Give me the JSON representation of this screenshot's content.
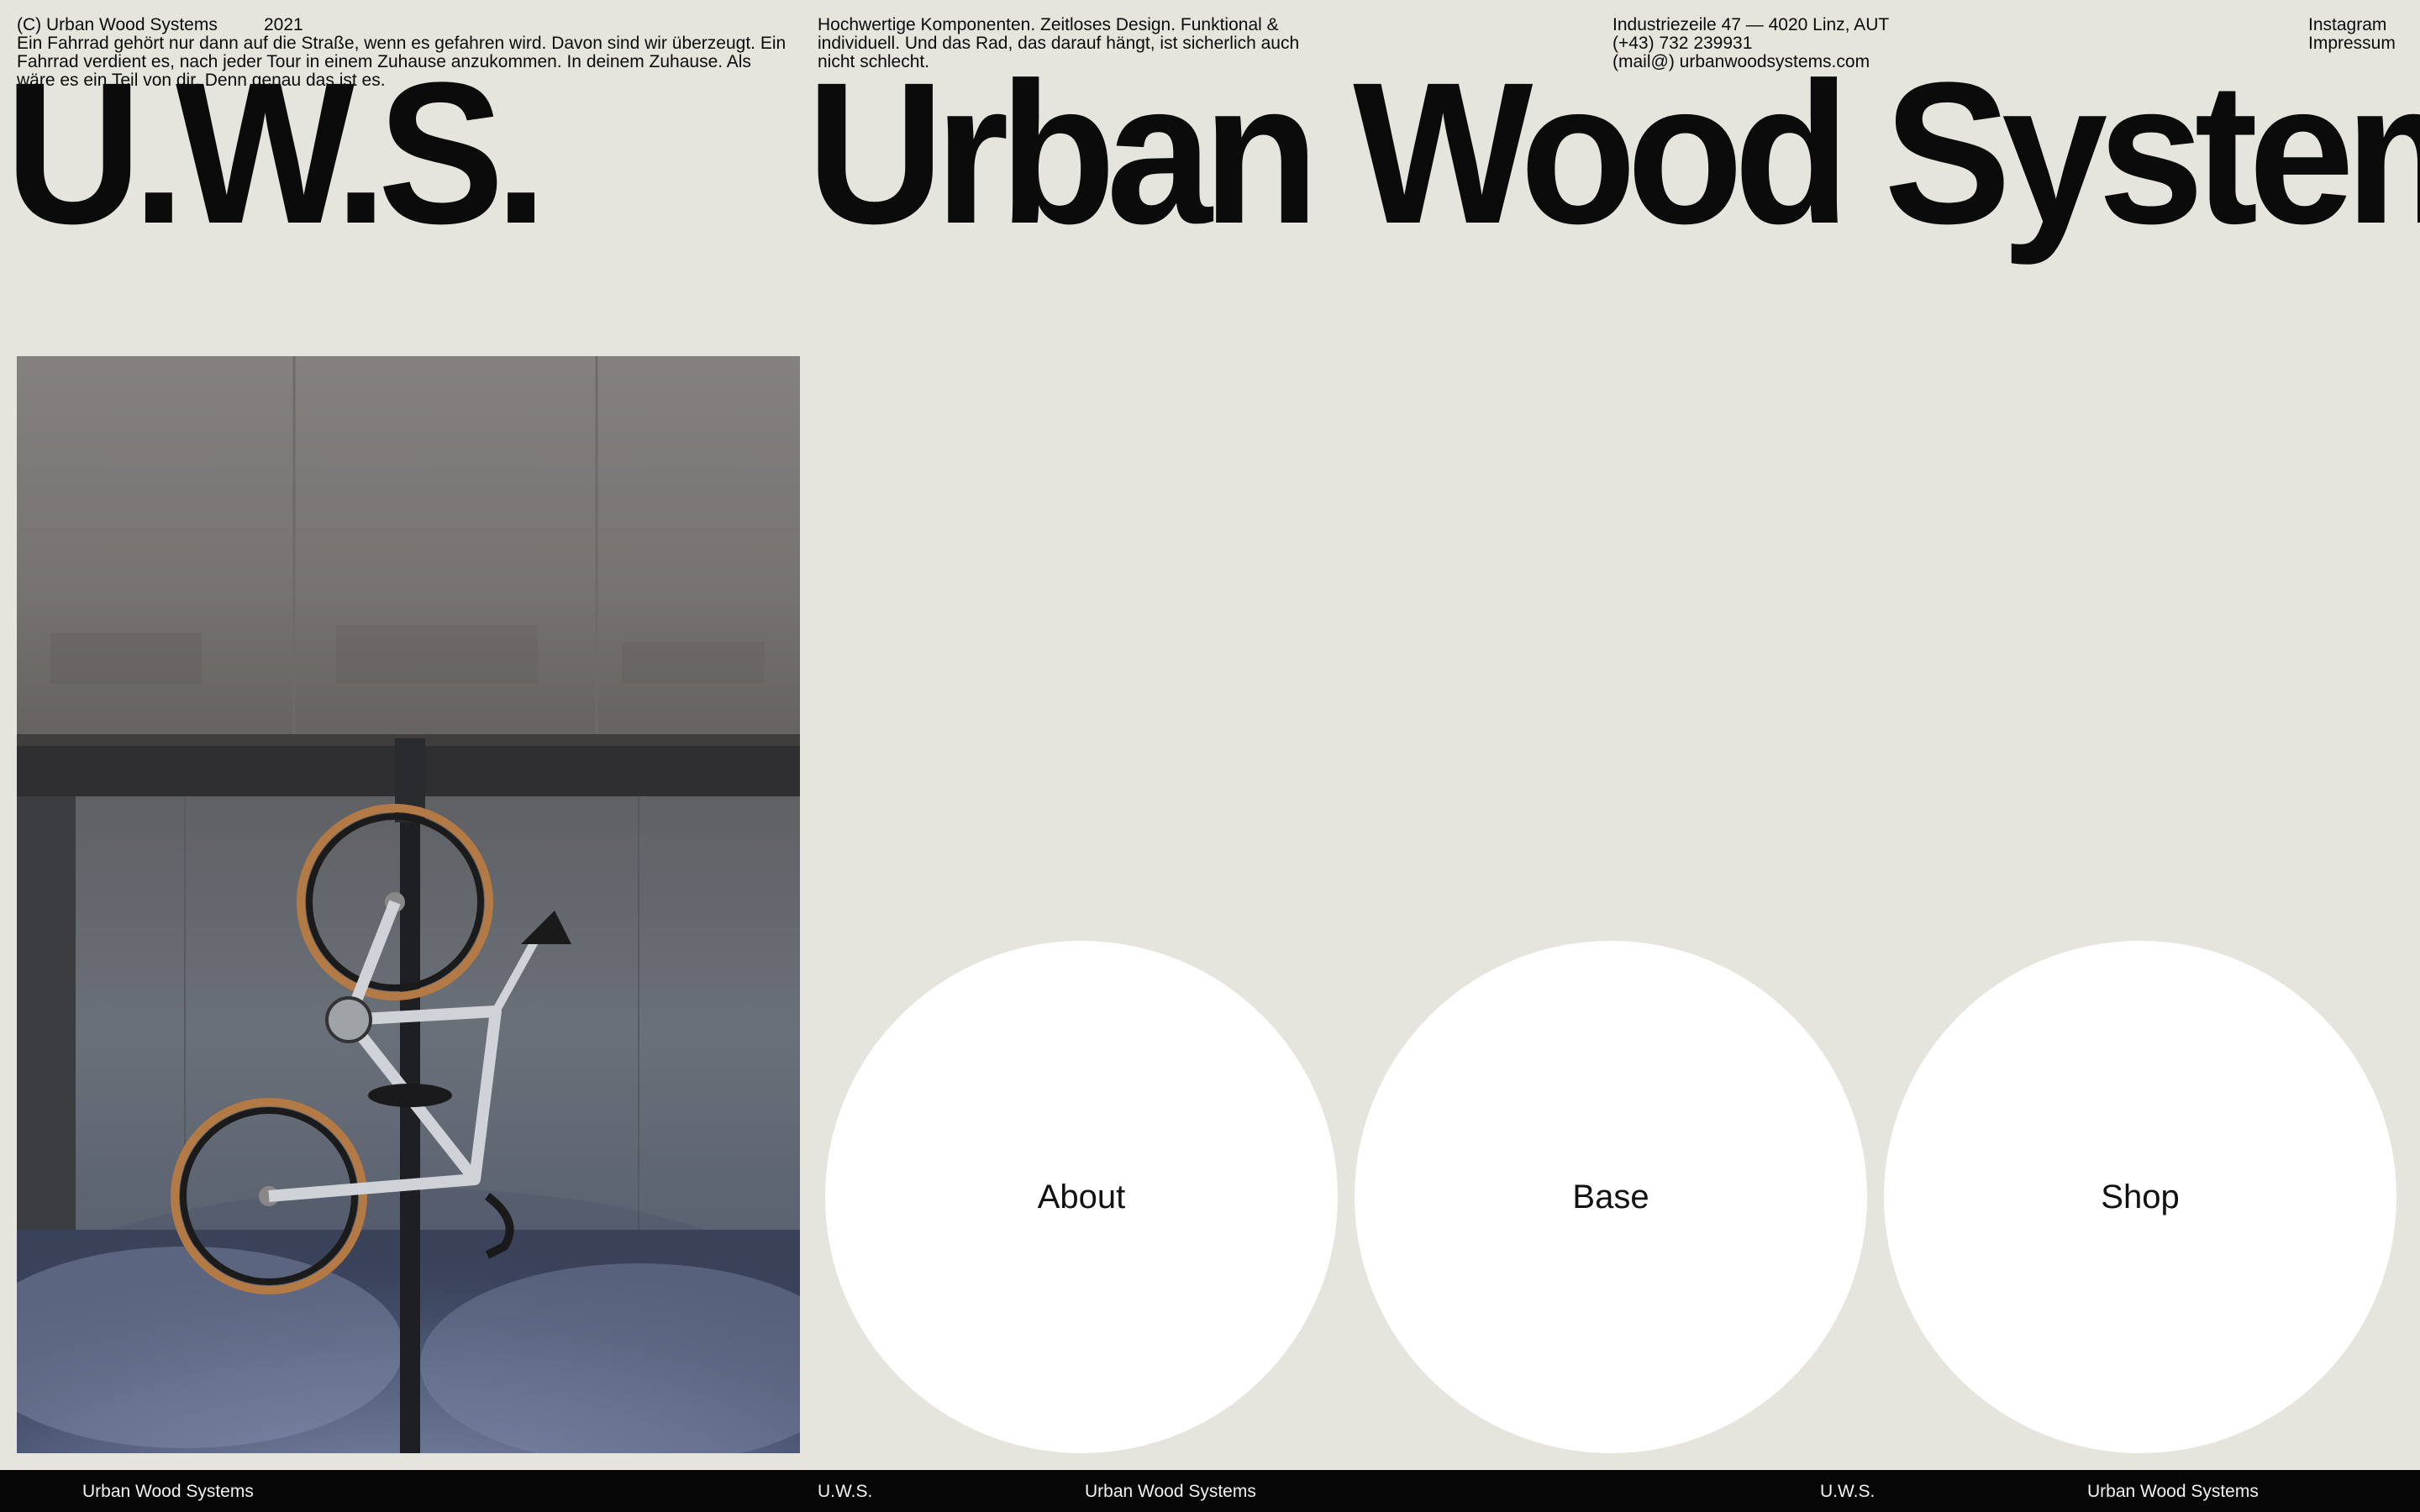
{
  "header": {
    "copyright": "(C) Urban Wood Systems",
    "year": "2021",
    "intro": "Ein Fahrrad gehört nur dann auf die Straße, wenn es gefahren wird. Davon sind wir überzeugt. Ein Fahrrad verdient es, nach jeder Tour in einem Zuhause anzukommen. In deinem Zuhause. Als wäre es ein Teil von dir. Denn genau das ist es.",
    "tagline": "Hochwertige Komponenten. Zeitloses Design. Funktional & individuell. Und das Rad, das darauf hängt, ist sicherlich auch nicht schlecht.",
    "address": "Industriezeile 47 — 4020 Linz, AUT",
    "phone": "(+43) 732 239931",
    "email": "(mail@) urbanwoodsystems.com",
    "instagram": "Instagram",
    "impressum": "Impressum"
  },
  "logo_text": "U.W.S.",
  "title_text": "Urban Wood Systems",
  "nav": {
    "about": "About",
    "base": "Base",
    "shop": "Shop"
  },
  "footer": {
    "items": [
      "Urban Wood Systems",
      "U.W.S.",
      "Urban Wood Systems",
      "U.W.S.",
      "Urban Wood Systems"
    ]
  },
  "colors": {
    "background": "#e5e5dd",
    "text": "#0b0b0b",
    "circle": "#ffffff",
    "footer_bg": "#060606",
    "footer_text": "#f2f2f2"
  },
  "hero_image": {
    "icon": "bike-wall-mount-photo"
  }
}
